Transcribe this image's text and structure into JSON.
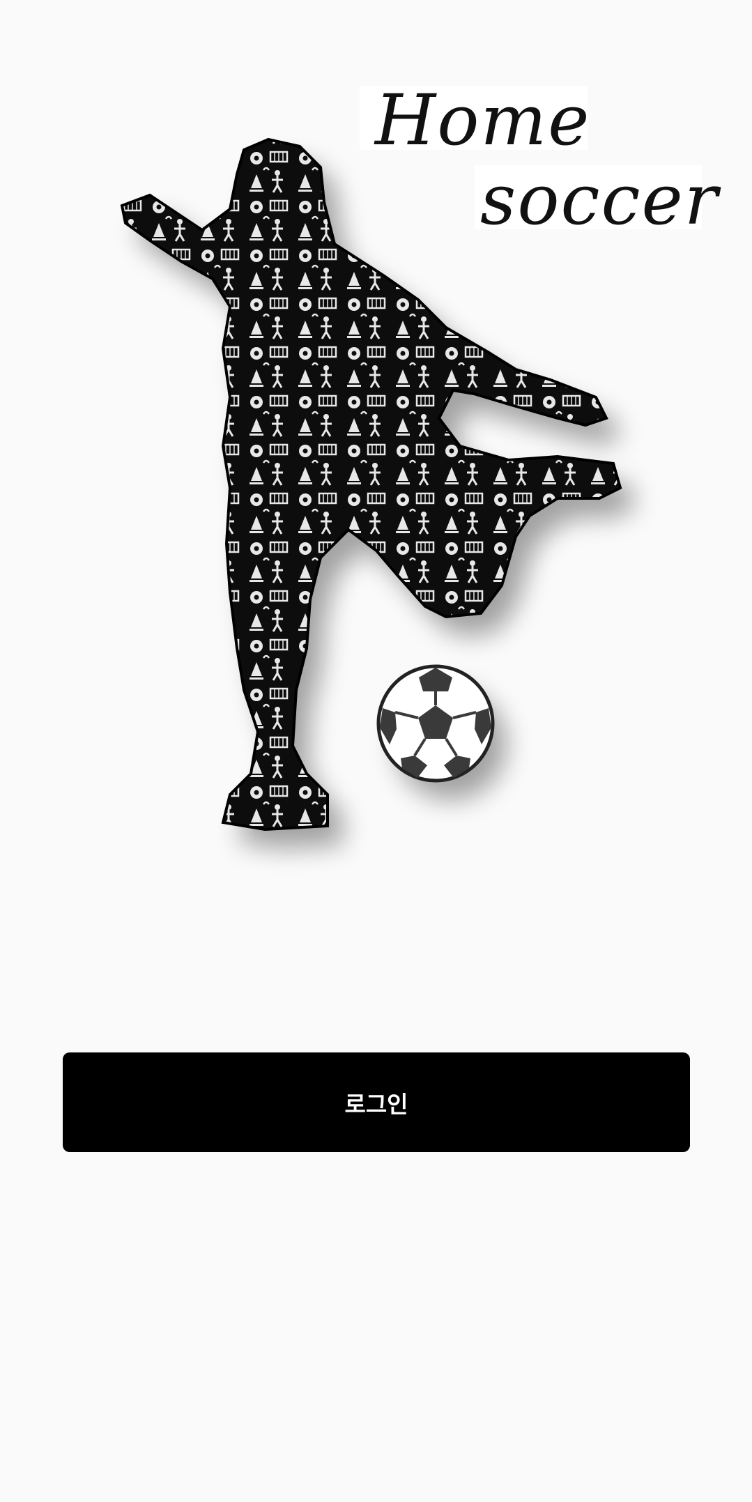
{
  "splash": {
    "logo": {
      "line1": "Home",
      "line2": "soccer"
    },
    "illustration": "soccer-player-kicking-ball"
  },
  "actions": {
    "login_label": "로그인"
  },
  "colors": {
    "background": "#fafafa",
    "button": "#000000",
    "button_text": "#ffffff"
  }
}
